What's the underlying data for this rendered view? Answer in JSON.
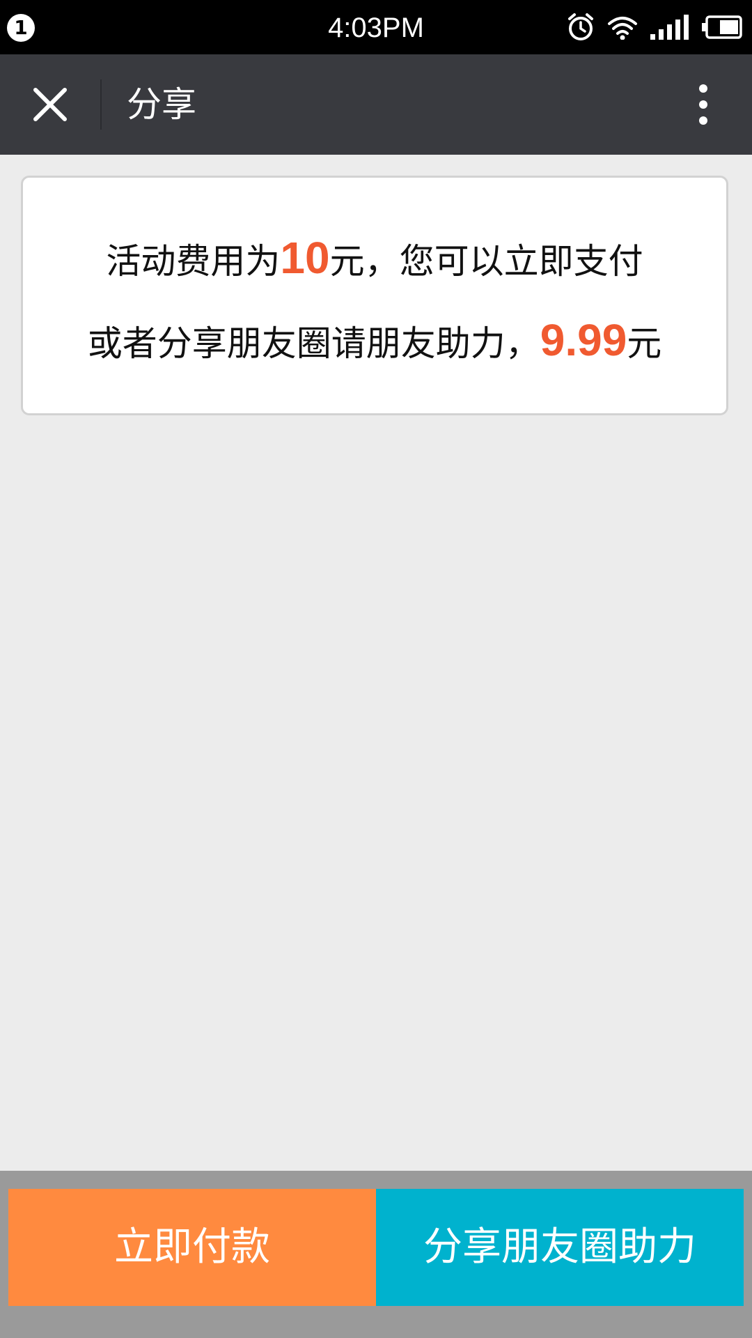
{
  "status_bar": {
    "notification_count": "1",
    "time": "4:03PM",
    "icons": [
      "alarm-icon",
      "wifi-icon",
      "signal-icon",
      "battery-icon"
    ]
  },
  "nav": {
    "title": "分享",
    "close_icon": "close-icon",
    "more_icon": "more-vertical-icon"
  },
  "message": {
    "line1_prefix": "活动费用为",
    "line1_amount": "10",
    "line1_suffix": "元，您可以立即支付",
    "line2_prefix": "或者分享朋友圈请朋友助力，",
    "line2_amount": "9.99",
    "line2_suffix": "元"
  },
  "actions": {
    "pay_label": "立即付款",
    "share_label": "分享朋友圈助力"
  },
  "colors": {
    "status_bar": "#000000",
    "nav_bar": "#393a3f",
    "background": "#ececec",
    "amount": "#f05a30",
    "pay_button": "#ff8a3f",
    "share_button": "#00b2ce",
    "bottom_bar": "#9a9a9a"
  }
}
